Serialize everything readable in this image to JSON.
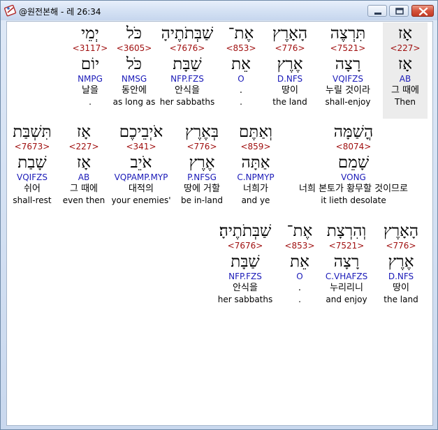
{
  "window": {
    "title": "@원전본해 - 레 26:34",
    "icon": "bible-app-icon",
    "buttons": {
      "minimize": "minimize-icon",
      "maximize": "maximize-icon",
      "close": "close-icon"
    }
  },
  "rows": [
    {
      "words": [
        {
          "heb": "אָז",
          "strong": "<227>",
          "lemma": "אָז",
          "morph": "AB",
          "ko": "그 때에",
          "en": "Then",
          "highlight": true
        },
        {
          "heb": "תִּרְצֶה",
          "strong": "<7521>",
          "lemma": "רָצָה",
          "morph": "VQIFZS",
          "ko": "누릴 것이라",
          "en": "shall-enjoy"
        },
        {
          "heb": "הָאָרֶץ",
          "strong": "<776>",
          "lemma": "אֶרֶץ",
          "morph": "D.NFS",
          "ko": "땅이",
          "en": "the land"
        },
        {
          "heb": "אֶת־",
          "strong": "<853>",
          "lemma": "אֵת",
          "morph": "O",
          "ko": ".",
          "en": "."
        },
        {
          "heb": "שַׁבְּתֹתֶיהָ",
          "strong": "<7676>",
          "lemma": "שַׁבָּת",
          "morph": "NFP.FZS",
          "ko": "안식을",
          "en": "her sabbaths"
        },
        {
          "heb": "כֹּל",
          "strong": "<3605>",
          "lemma": "כֹּל",
          "morph": "NMSG",
          "ko": "동안에",
          "en": "as long as"
        },
        {
          "heb": "יְמֵי",
          "strong": "<3117>",
          "lemma": "יוֹם",
          "morph": "NMPG",
          "ko": "날을",
          "en": "."
        }
      ]
    },
    {
      "words": [
        {
          "heb": "הֳשַׁמָּה",
          "strong": "<8074>",
          "lemma": "שָׁמֵם",
          "morph": "VONG",
          "ko": "너희 본토가 황무할 것이므로",
          "en": "it lieth desolate"
        },
        {
          "heb": "וְאַתֶּם",
          "strong": "<859>",
          "lemma": "אַתָּה",
          "morph": "C.NPMYP",
          "ko": "너희가",
          "en": "and ye"
        },
        {
          "heb": "בְּאֶרֶץ",
          "strong": "<776>",
          "lemma": "אֶרֶץ",
          "morph": "P.NFSG",
          "ko": "땅에 거할",
          "en": "be in-land"
        },
        {
          "heb": "אֹיְבֵיכֶם",
          "strong": "<341>",
          "lemma": "אֹיֵב",
          "morph": "VQPAMP.MYP",
          "ko": "대적의",
          "en": "your enemies'"
        },
        {
          "heb": "אָז",
          "strong": "<227>",
          "lemma": "אָז",
          "morph": "AB",
          "ko": "그 때에",
          "en": "even then"
        },
        {
          "heb": "תִּשְׁבַּת",
          "strong": "<7673>",
          "lemma": "שָׁבַת",
          "morph": "VQIFZS",
          "ko": "쉬어",
          "en": "shall-rest"
        }
      ]
    },
    {
      "words": [
        {
          "heb": "הָאָרֶץ",
          "strong": "<776>",
          "lemma": "אֶרֶץ",
          "morph": "D.NFS",
          "ko": "땅이",
          "en": "the land"
        },
        {
          "heb": "וְהִרְצָת",
          "strong": "<7521>",
          "lemma": "רָצָה",
          "morph": "C.VHAFZS",
          "ko": "누리리니",
          "en": "and enjoy"
        },
        {
          "heb": "אֶת־",
          "strong": "<853>",
          "lemma": "אֵת",
          "morph": "O",
          "ko": ".",
          "en": "."
        },
        {
          "heb": "שַׁבְּתֹתֶיהָ׃",
          "strong": "<7676>",
          "lemma": "שַׁבָּת",
          "morph": "NFP.FZS",
          "ko": "안식을",
          "en": "her sabbaths"
        }
      ]
    }
  ]
}
